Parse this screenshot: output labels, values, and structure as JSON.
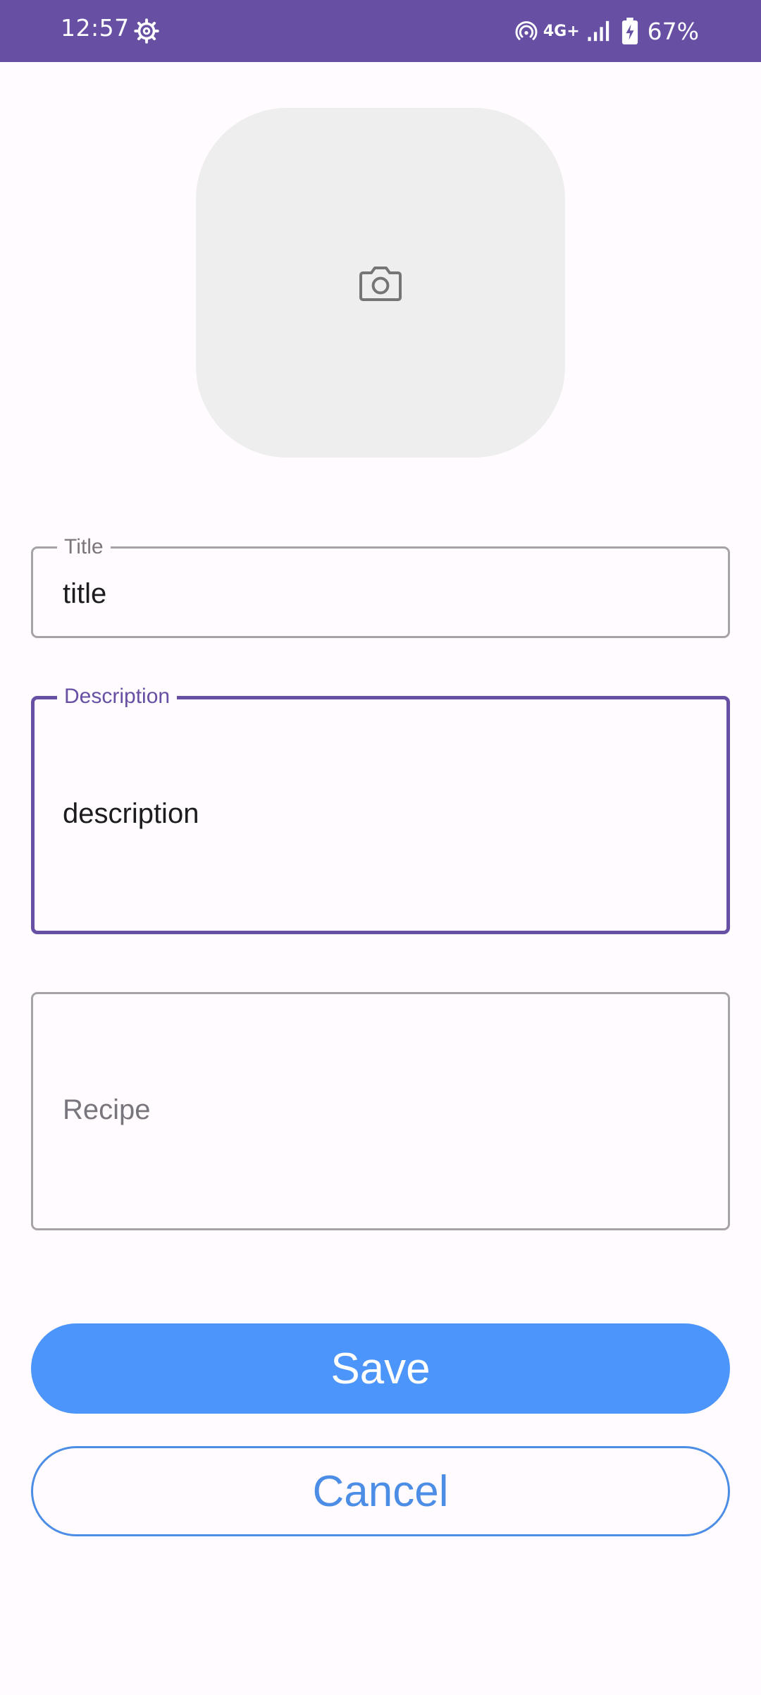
{
  "status_bar": {
    "time": "12:57",
    "network": "4G+",
    "battery": "67%",
    "icons": [
      "settings-gear-icon",
      "hotspot-icon",
      "signal-icon",
      "battery-charging-icon"
    ],
    "background": "#6750A4"
  },
  "photo_picker": {
    "icon": "camera-icon"
  },
  "form": {
    "title": {
      "label": "Title",
      "value": "title"
    },
    "description": {
      "label": "Description",
      "value": "description"
    },
    "recipe": {
      "placeholder": "Recipe"
    }
  },
  "actions": {
    "save_label": "Save",
    "cancel_label": "Cancel"
  },
  "colors": {
    "accent": "#6750A4",
    "primary_button": "#4C95FA",
    "outline_button": "#4C8DE6"
  }
}
